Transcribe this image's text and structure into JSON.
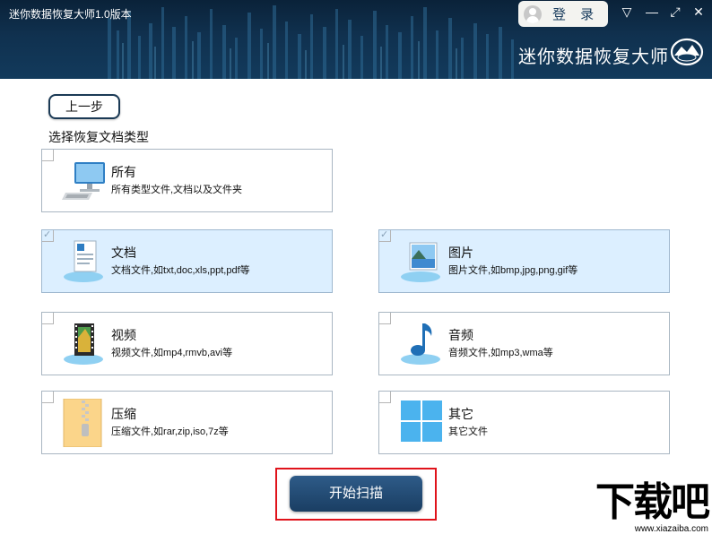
{
  "window": {
    "title": "迷你数据恢复大师1.0版本",
    "login_label": "登 录",
    "controls": [
      "▽",
      "—",
      "⤢",
      "✕"
    ],
    "brand_name": "迷你数据恢复大师"
  },
  "nav": {
    "back_label": "上一步"
  },
  "section": {
    "label": "选择恢复文档类型"
  },
  "types": [
    {
      "id": "all",
      "title": "所有",
      "desc": "所有类型文件,文档以及文件夹",
      "checked": false
    },
    {
      "id": "document",
      "title": "文档",
      "desc": "文档文件,如txt,doc,xls,ppt,pdf等",
      "checked": true
    },
    {
      "id": "image",
      "title": "图片",
      "desc": "图片文件,如bmp,jpg,png,gif等",
      "checked": true
    },
    {
      "id": "video",
      "title": "视频",
      "desc": "视频文件,如mp4,rmvb,avi等",
      "checked": false
    },
    {
      "id": "audio",
      "title": "音频",
      "desc": "音频文件,如mp3,wma等",
      "checked": false
    },
    {
      "id": "archive",
      "title": "压缩",
      "desc": "压缩文件,如rar,zip,iso,7z等",
      "checked": false
    },
    {
      "id": "other",
      "title": "其它",
      "desc": "其它文件",
      "checked": false
    }
  ],
  "action": {
    "scan_label": "开始扫描"
  },
  "watermark": {
    "big": "下载吧",
    "small": "www.xiazaiba.com"
  },
  "colors": {
    "header": "#10314f",
    "checked_bg": "#dcefff",
    "highlight": "#e0131b",
    "button": "#1f4770"
  }
}
